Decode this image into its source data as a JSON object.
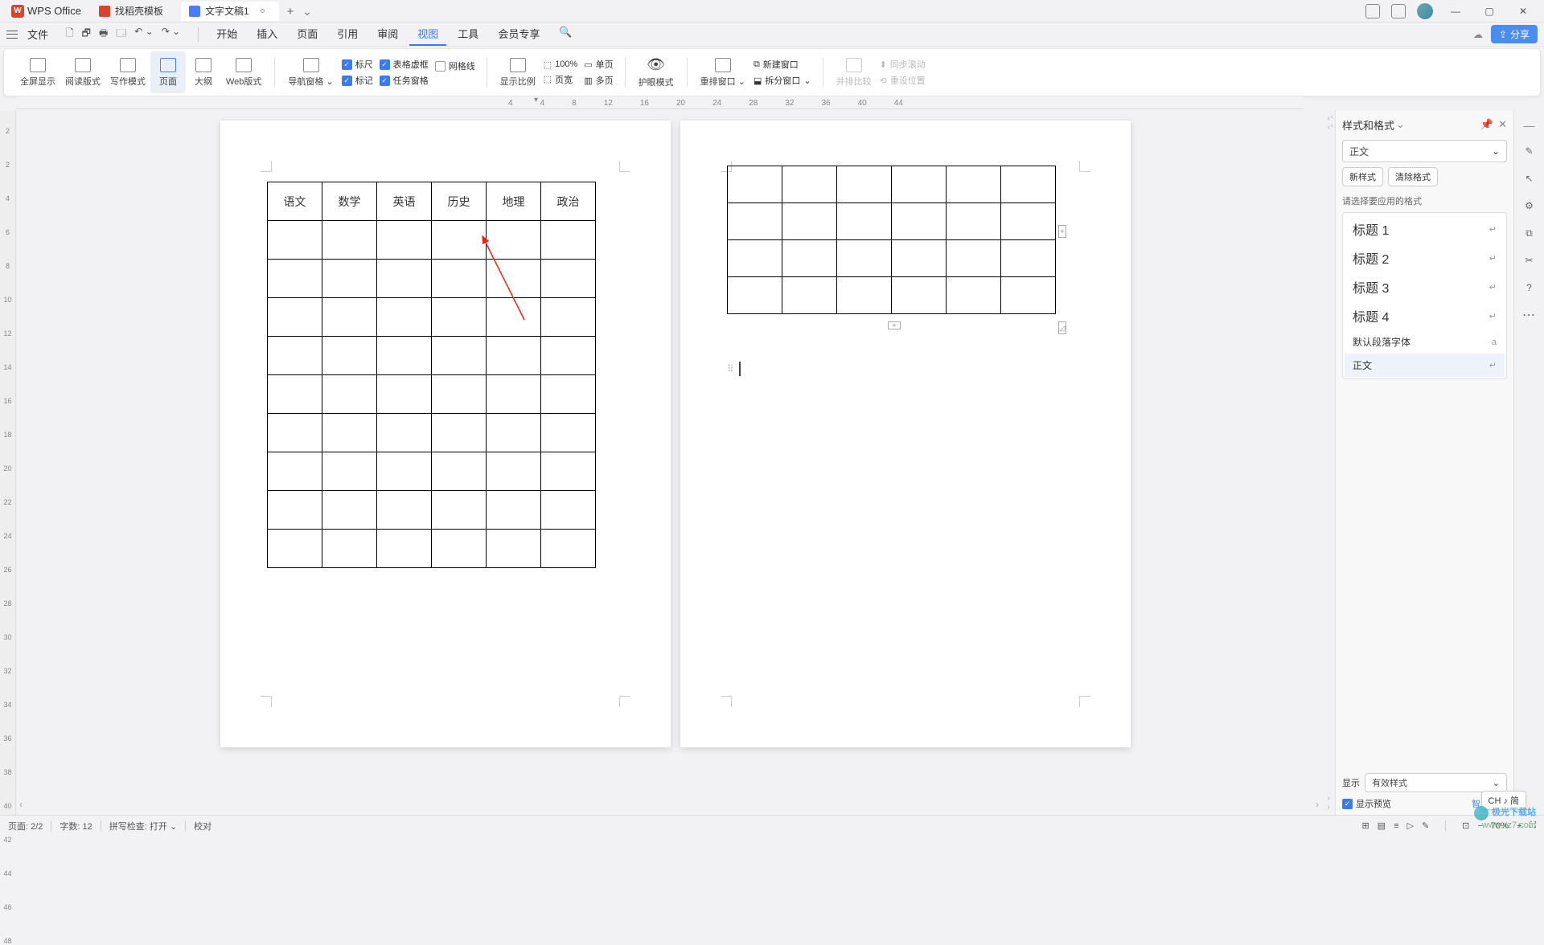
{
  "titlebar": {
    "app_name": "WPS Office",
    "tabs": [
      {
        "label": "找稻壳模板",
        "icon": "red",
        "active": false
      },
      {
        "label": "文字文稿1",
        "icon": "blue",
        "active": true
      }
    ],
    "add_tab": "+"
  },
  "menubar": {
    "file": "文件",
    "items": [
      "开始",
      "插入",
      "页面",
      "引用",
      "审阅",
      "视图",
      "工具",
      "会员专享"
    ],
    "active_index": 5,
    "share": "分享"
  },
  "ribbon": {
    "group1": [
      "全屏显示",
      "阅读版式",
      "写作模式",
      "页面",
      "大纲",
      "Web版式"
    ],
    "group1_active": 3,
    "nav_pane": "导航窗格",
    "checks": {
      "ruler": {
        "label": "标尺",
        "on": true
      },
      "table_dash": {
        "label": "表格虚框",
        "on": true
      },
      "gridlines": {
        "label": "网格线",
        "on": false
      },
      "marks": {
        "label": "标记",
        "on": true
      },
      "task_pane": {
        "label": "任务窗格",
        "on": true
      }
    },
    "zoom_group": {
      "scale": "显示比例",
      "p100": "100%",
      "pagewidth": "页宽",
      "single": "单页",
      "multi": "多页"
    },
    "eye_care": "护眼模式",
    "arrange": "重排窗口",
    "split": "拆分窗口",
    "new_window": "新建窗口",
    "compare": "并排比较",
    "sync_scroll": "同步滚动",
    "reset_pos": "重设位置"
  },
  "ruler": {
    "marks": [
      "4",
      "4",
      "8",
      "12",
      "16",
      "20",
      "24",
      "28",
      "32",
      "36",
      "40",
      "44"
    ]
  },
  "vruler": {
    "marks": [
      "2",
      "2",
      "4",
      "6",
      "8",
      "10",
      "12",
      "14",
      "16",
      "18",
      "20",
      "22",
      "24",
      "26",
      "28",
      "30",
      "32",
      "34",
      "36",
      "38",
      "40",
      "42",
      "44",
      "46",
      "48"
    ]
  },
  "document": {
    "page1": {
      "table_headers": [
        "语文",
        "数学",
        "英语",
        "历史",
        "地理",
        "政治"
      ],
      "rows": 10,
      "cols": 6
    },
    "page2": {
      "rows": 4,
      "cols": 6
    }
  },
  "sidepanel": {
    "title": "样式和格式",
    "current_style": "正文",
    "new_style": "新样式",
    "clear_format": "清除格式",
    "apply_label": "请选择要应用的格式",
    "styles": [
      "标题 1",
      "标题 2",
      "标题 3",
      "标题 4"
    ],
    "default_font": "默认段落字体",
    "body": "正文",
    "show_label": "显示",
    "show_value": "有效样式",
    "preview_label": "显示预览",
    "smart_layout": "智能排版"
  },
  "statusbar": {
    "page": "页面: 2/2",
    "words": "字数: 12",
    "spell": "拼写检查: 打开",
    "proof": "校对",
    "zoom": "70%"
  },
  "lang_badge": "CH ♪ 简",
  "watermark": {
    "line1": "极光下载站",
    "line2": "www.xz7.com"
  }
}
